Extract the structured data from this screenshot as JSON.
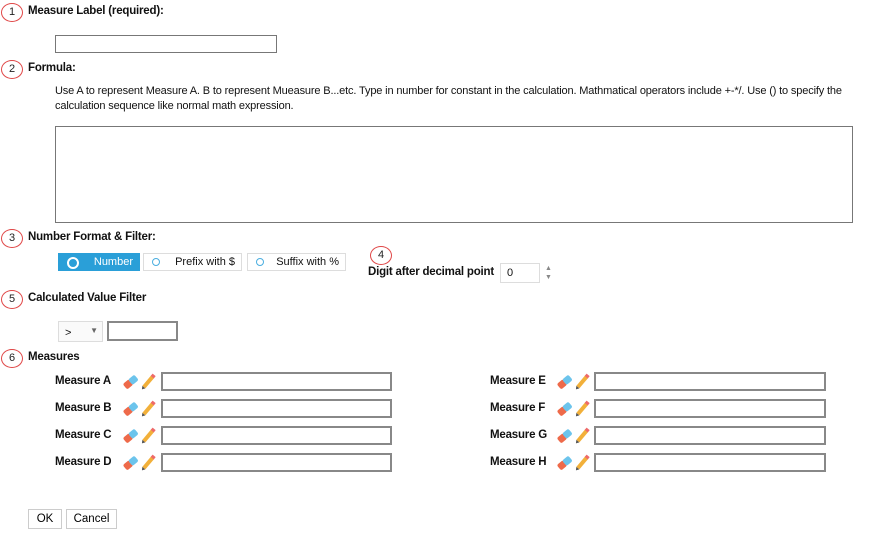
{
  "sections": [
    {
      "number": "1",
      "label": "Measure Label (required):"
    },
    {
      "number": "2",
      "label": "Formula:"
    },
    {
      "number": "3",
      "label": "Number Format & Filter:"
    },
    {
      "number": "4",
      "label": "Digit after decimal point"
    },
    {
      "number": "5",
      "label": "Calculated Value Filter"
    },
    {
      "number": "6",
      "label": "Measures"
    }
  ],
  "measure_label": {
    "value": ""
  },
  "formula": {
    "description": "Use A to represent Measure A. B to represent Mueasure B...etc. Type in number for constant in the calculation. Mathmatical operators include +-*/. Use () to specify the calculation sequence like normal math expression.",
    "value": ""
  },
  "number_format": {
    "options": [
      "Number",
      "Prefix with $",
      "Suffix with %"
    ],
    "selected": "Number",
    "accent": "#2a9fd8"
  },
  "decimal": {
    "value": "0"
  },
  "filter": {
    "operator": ">",
    "value": ""
  },
  "measures": [
    {
      "label": "Measure A",
      "value": ""
    },
    {
      "label": "Measure B",
      "value": ""
    },
    {
      "label": "Measure C",
      "value": ""
    },
    {
      "label": "Measure D",
      "value": ""
    },
    {
      "label": "Measure E",
      "value": ""
    },
    {
      "label": "Measure F",
      "value": ""
    },
    {
      "label": "Measure G",
      "value": ""
    },
    {
      "label": "Measure H",
      "value": ""
    }
  ],
  "buttons": {
    "ok": "OK",
    "cancel": "Cancel"
  }
}
